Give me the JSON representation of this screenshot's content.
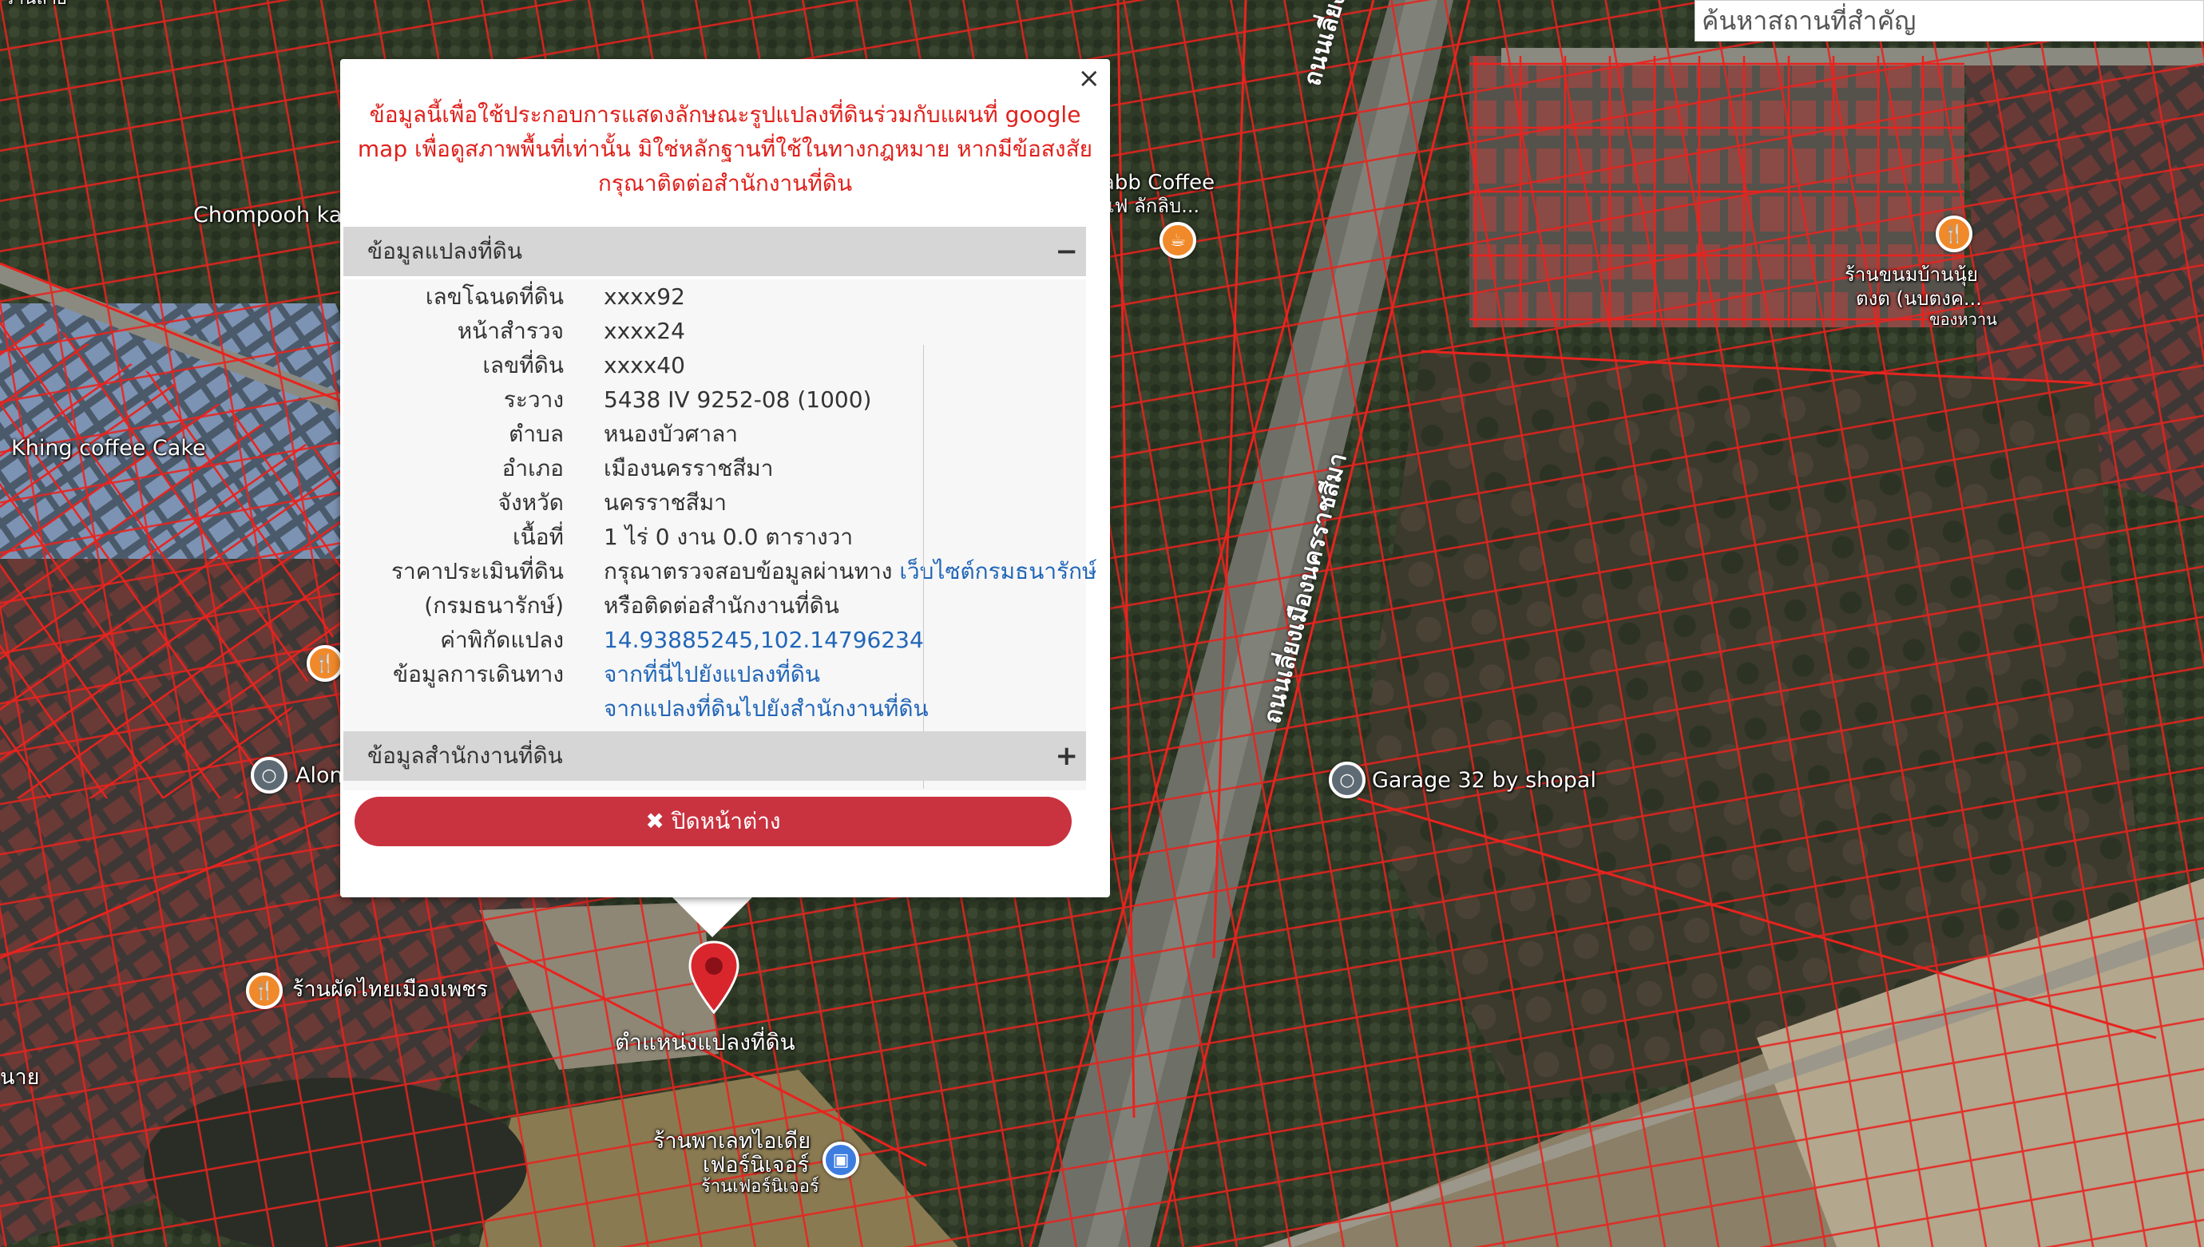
{
  "search": {
    "placeholder": "ค้นหาสถานที่สำคัญ"
  },
  "map": {
    "place_labels": {
      "chompooh": "Chompooh ka",
      "khing_coffee": "Khing coffee Cake",
      "alon": "Alon",
      "garage": "Garage 32 by shopal",
      "abb_coffee_1": "abb Coffee",
      "abb_coffee_2": "แฟ ลักลิบ...",
      "village_sign_1": "ร้านขนมบ้านนุ้ย",
      "village_sign_2": "ตงต (นบตงค...",
      "village_sign_3": "ของหวาน",
      "restaurant_thai": "ร้านผัดไทยเมืองเพชร",
      "furniture_1": "ร้านพาเลทไอเดีย",
      "furniture_2": "เฟอร์นิเจอร์",
      "furniture_3": "ร้านเฟอร์นิเจอร์",
      "edge_left": "นาย",
      "top_left": "ร้านลาย"
    },
    "road_labels": {
      "bypass_upper": "ถนนเลี่ยงเมือง",
      "bypass_middle": "ถนนเลี่ยงเมืองนครราชสีมา",
      "bypass_lower": "ถนนเลี่ยงเมืองนครราชสีมา"
    },
    "marker_label": "ตำแหน่งแปลงที่ดิน",
    "colors": {
      "parcel_line": "#e8231e",
      "marker": "#d9262d"
    }
  },
  "popup": {
    "close_symbol": "×",
    "disclaimer": "ข้อมูลนี้เพื่อใช้ประกอบการแสดงลักษณะรูปแปลงที่ดินร่วมกับแผนที่ google map เพื่อดูสภาพพื้นที่เท่านั้น มิใช่หลักฐานที่ใช้ในทางกฎหมาย หากมีข้อสงสัย กรุณาติดต่อสำนักงานที่ดิน",
    "land_panel": {
      "title": "ข้อมูลแปลงที่ดิน",
      "toggle": "−",
      "rows": [
        {
          "key": "เลขโฉนดที่ดิน",
          "value": "xxxx92"
        },
        {
          "key": "หน้าสำรวจ",
          "value": "xxxx24"
        },
        {
          "key": "เลขที่ดิน",
          "value": "xxxx40"
        },
        {
          "key": "ระวาง",
          "value": "5438 IV 9252-08 (1000)"
        },
        {
          "key": "ตำบล",
          "value": "หนองบัวศาลา"
        },
        {
          "key": "อำเภอ",
          "value": "เมืองนครราชสีมา"
        },
        {
          "key": "จังหวัด",
          "value": "นครราชสีมา"
        },
        {
          "key": "เนื้อที่",
          "value": "1 ไร่ 0 งาน 0.0 ตารางวา"
        }
      ],
      "price_key": "ราคาประเมินที่ดิน",
      "price_key_2": "(กรมธนารักษ์)",
      "price_text": "กรุณาตรวจสอบข้อมูลผ่านทาง",
      "price_link": "เว็บไซต์กรมธนารักษ์",
      "price_text_2": "หรือติดต่อสำนักงานที่ดิน",
      "coord_key": "ค่าพิกัดแปลง",
      "coord_value": "14.93885245,102.14796234",
      "travel_key": "ข้อมูลการเดินทาง",
      "travel_link_1": "จากที่นี่ไปยังแปลงที่ดิน",
      "travel_link_2": "จากแปลงที่ดินไปยังสำนักงานที่ดิน"
    },
    "office_panel": {
      "title": "ข้อมูลสำนักงานที่ดิน",
      "toggle": "+"
    },
    "close_button": "✖ ปิดหน้าต่าง"
  }
}
